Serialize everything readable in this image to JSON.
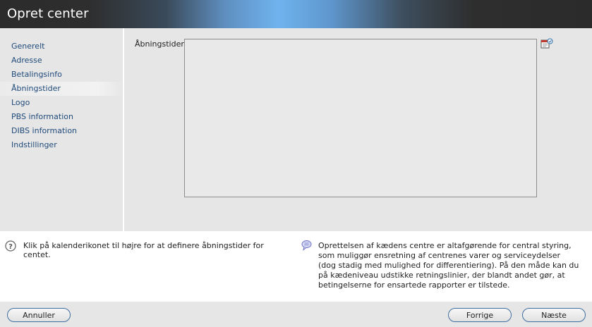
{
  "window": {
    "title": "Opret center"
  },
  "sidebar": {
    "items": [
      {
        "label": "Generelt"
      },
      {
        "label": "Adresse"
      },
      {
        "label": "Betalingsinfo"
      },
      {
        "label": "Åbningstider"
      },
      {
        "label": "Logo"
      },
      {
        "label": "PBS information"
      },
      {
        "label": "DIBS information"
      },
      {
        "label": "Indstillinger"
      }
    ],
    "active_index": 3
  },
  "main": {
    "field_label": "Åbningstider",
    "textarea_value": "",
    "calendar_icon": "calendar-edit-icon"
  },
  "help": {
    "hint_icon": "question-circle-icon",
    "hint_text": "Klik på kalenderikonet til højre for at definere åbningstider for centet.",
    "info_icon": "speech-bubble-icon",
    "info_text": "Oprettelsen af kædens centre er altafgørende for central styring, som muliggør ensretning af centrenes varer og serviceydelser (dog stadig med mulighed for differentiering). På den måde kan du på kædeniveau udstikke retningslinier, der blandt andet gør, at betingelserne for ensartede rapporter er tilstede."
  },
  "footer": {
    "cancel_label": "Annuller",
    "prev_label": "Forrige",
    "next_label": "Næste"
  },
  "colors": {
    "nav_link": "#1f4a7a",
    "button_border": "#3f6f9f",
    "title_accent": "#6fb3ee"
  }
}
